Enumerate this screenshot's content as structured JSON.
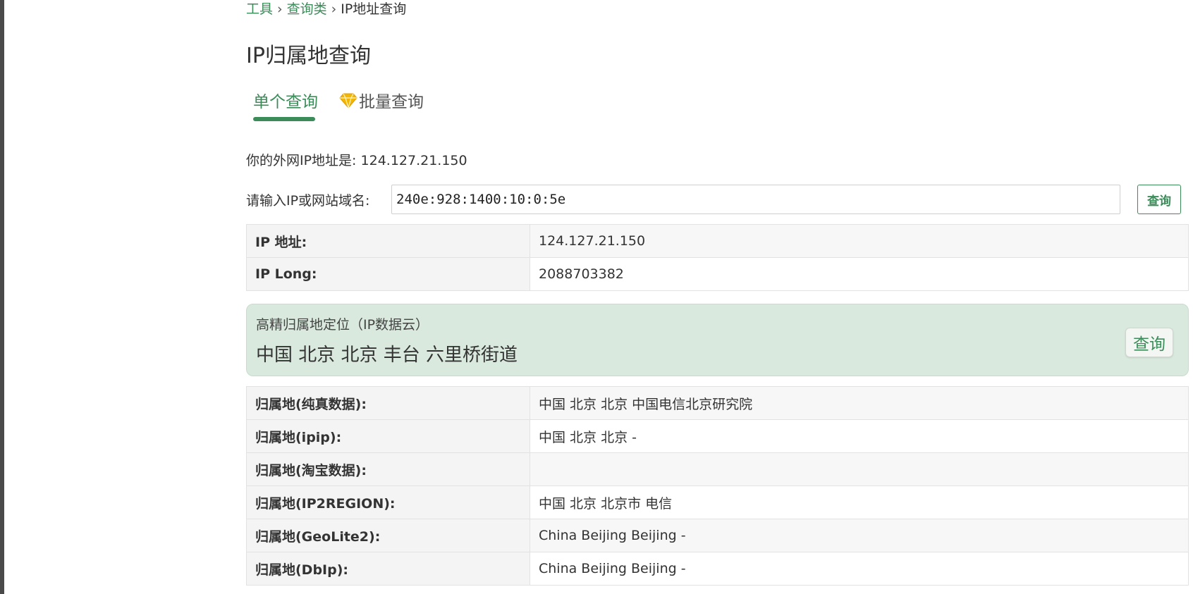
{
  "breadcrumb": {
    "items": [
      "工具",
      "查询类"
    ],
    "separator": "›",
    "current": "IP地址查询"
  },
  "page": {
    "title": "IP归属地查询"
  },
  "tabs": [
    {
      "label": "单个查询",
      "active": true
    },
    {
      "label": "批量查询",
      "icon": "diamond-icon",
      "active": false
    }
  ],
  "my_ip": {
    "label": "你的外网IP地址是:",
    "value": "124.127.21.150"
  },
  "query": {
    "label": "请输入IP或网站域名:",
    "value": "240e:928:1400:10:0:5e",
    "button": "查询"
  },
  "basic_info": [
    {
      "key": "IP 地址:",
      "value": "124.127.21.150"
    },
    {
      "key": "IP Long:",
      "value": "2088703382"
    }
  ],
  "precise_location": {
    "title": "高精归属地定位（IP数据云）",
    "result": "中国 北京 北京 丰台 六里桥街道",
    "button": "查询"
  },
  "locations": [
    {
      "key": "归属地(纯真数据):",
      "value": "中国 北京 北京 中国电信北京研究院"
    },
    {
      "key": "归属地(ipip):",
      "value": "中国 北京 北京 -"
    },
    {
      "key": "归属地(淘宝数据):",
      "value": ""
    },
    {
      "key": "归属地(IP2REGION):",
      "value": "中国 北京 北京市 电信"
    },
    {
      "key": "归属地(GeoLite2):",
      "value": "China Beijing Beijing -"
    },
    {
      "key": "归属地(DbIp):",
      "value": "China Beijing Beijing -"
    }
  ],
  "colors": {
    "accent": "#3c8c5a",
    "highlight_bg": "#d9e9de",
    "gem": "#f2b705"
  }
}
